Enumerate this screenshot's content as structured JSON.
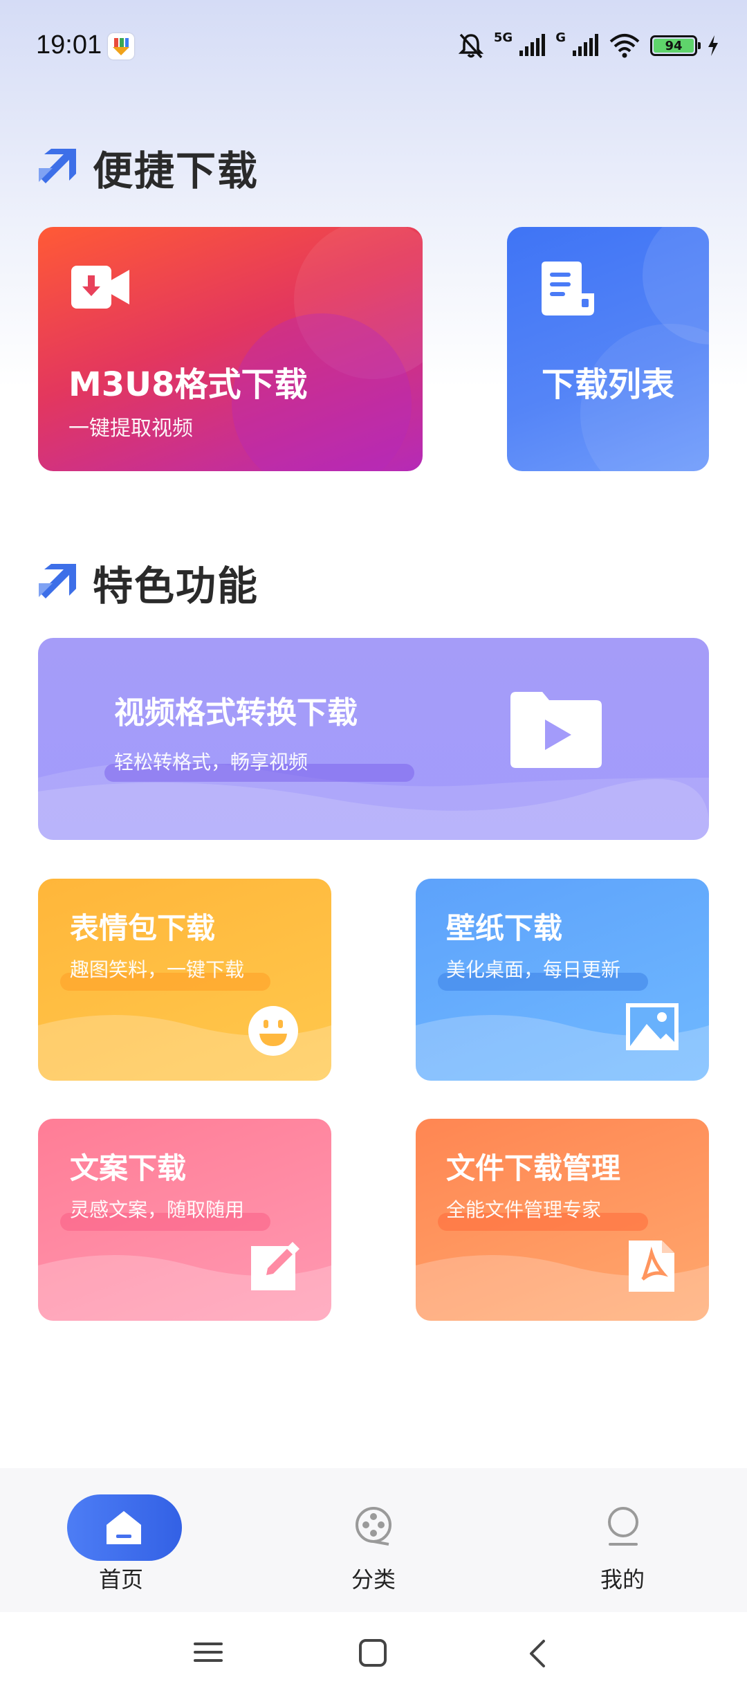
{
  "status_bar": {
    "time": "19:01",
    "network_1": "5G",
    "network_2": "G",
    "battery": "94",
    "icons": [
      "app-notification-icon",
      "mute-bell-icon",
      "signal-icon",
      "wifi-icon",
      "battery-icon",
      "charging-icon"
    ]
  },
  "section_quick": {
    "title": "便捷下载"
  },
  "section_features": {
    "title": "特色功能"
  },
  "cards": {
    "m3u8": {
      "title": "M3U8格式下载",
      "subtitle": "一键提取视频",
      "icon": "video-download-icon"
    },
    "download_list": {
      "title": "下载列表",
      "icon": "document-list-icon"
    },
    "convert": {
      "title": "视频格式转换下载",
      "subtitle": "轻松转格式，畅享视频",
      "icon": "video-folder-icon"
    },
    "emoji": {
      "title": "表情包下载",
      "subtitle": "趣图笑料，一键下载",
      "icon": "smiley-icon"
    },
    "wallpaper": {
      "title": "壁纸下载",
      "subtitle": "美化桌面，每日更新",
      "icon": "image-icon"
    },
    "copywriting": {
      "title": "文案下载",
      "subtitle": "灵感文案，随取随用",
      "icon": "edit-icon"
    },
    "files": {
      "title": "文件下载管理",
      "subtitle": "全能文件管理专家",
      "icon": "pdf-file-icon"
    }
  },
  "bottom_nav": {
    "items": [
      {
        "label": "首页",
        "icon": "home-icon",
        "active": true
      },
      {
        "label": "分类",
        "icon": "film-reel-icon",
        "active": false
      },
      {
        "label": "我的",
        "icon": "profile-icon",
        "active": false
      }
    ]
  },
  "system_nav": {
    "icons": [
      "menu-icon",
      "home-square-icon",
      "back-icon"
    ]
  },
  "colors": {
    "accent": "#3f6ff0",
    "m3u8": "#e3375e",
    "list": "#4f80f6",
    "convert": "#a39bfa",
    "emoji": "#ffbe40",
    "wallpaper": "#65aefc",
    "copy": "#ff8ba4",
    "files": "#ff955e"
  }
}
